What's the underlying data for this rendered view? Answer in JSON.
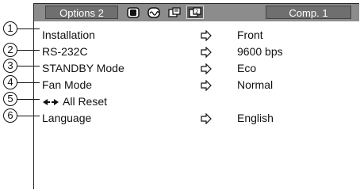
{
  "menu": {
    "tab_title": "Options 2",
    "comp_label": "Comp. 1",
    "tab_icons": [
      "picture-icon",
      "audio-wave-icon",
      "options1-icon",
      "options2-icon"
    ],
    "items": [
      {
        "num": "1",
        "label": "Installation",
        "value": "Front"
      },
      {
        "num": "2",
        "label": "RS-232C",
        "value": "9600 bps"
      },
      {
        "num": "3",
        "label": "STANDBY Mode",
        "value": "Eco"
      },
      {
        "num": "4",
        "label": "Fan Mode",
        "value": "Normal"
      },
      {
        "num": "5",
        "label": "All Reset",
        "value": ""
      },
      {
        "num": "6",
        "label": "Language",
        "value": "English"
      }
    ]
  },
  "colors": {
    "bar": "#8c8c8c",
    "tab": "#6f6f6f",
    "arrow_fill": "#ffffff"
  }
}
